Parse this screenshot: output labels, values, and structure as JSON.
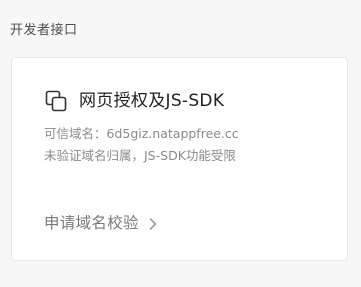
{
  "section": {
    "title": "开发者接口"
  },
  "card": {
    "icon": "copy-squares-icon",
    "title": "网页授权及JS-SDK",
    "trusted_domain_label": "可信域名：",
    "trusted_domain_value": "6d5giz.natappfree.cc",
    "status_text": "未验证域名归属，JS-SDK功能受限",
    "action_label": "申请域名校验",
    "action_icon": "chevron-right-icon"
  },
  "colors": {
    "page_bg": "#f7f7f7",
    "card_bg": "#ffffff",
    "title_text": "#1f1f1f",
    "muted_text": "#8a8a8a"
  }
}
